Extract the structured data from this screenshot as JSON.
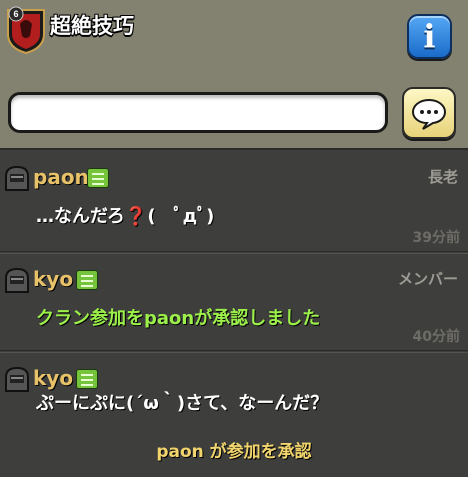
{
  "header": {
    "clan_name": "超絶技巧",
    "badge_level": "6",
    "info_label": "i",
    "chat_input": {
      "value": "",
      "placeholder": ""
    }
  },
  "messages": [
    {
      "author": "paon",
      "role": "長老",
      "text_prefix": "…なんだろ",
      "text_mark": "❓",
      "text_suffix": "(　ﾟдﾟ)",
      "time": "39分前"
    },
    {
      "author": "kyo",
      "role": "メンバー",
      "text": "クラン参加をpaonが承認しました",
      "time": "40分前"
    },
    {
      "author": "kyo",
      "role": "",
      "text": "ぷーにぷに(´ω｀)さて、なーんだ？",
      "system": "paon が参加を承認"
    }
  ],
  "colors": {
    "header_bg": "#838170",
    "chat_bg": "#3e3e3c",
    "author": "#e8c268",
    "system_green": "#9cf04a",
    "system_yellow": "#f2d56c"
  }
}
